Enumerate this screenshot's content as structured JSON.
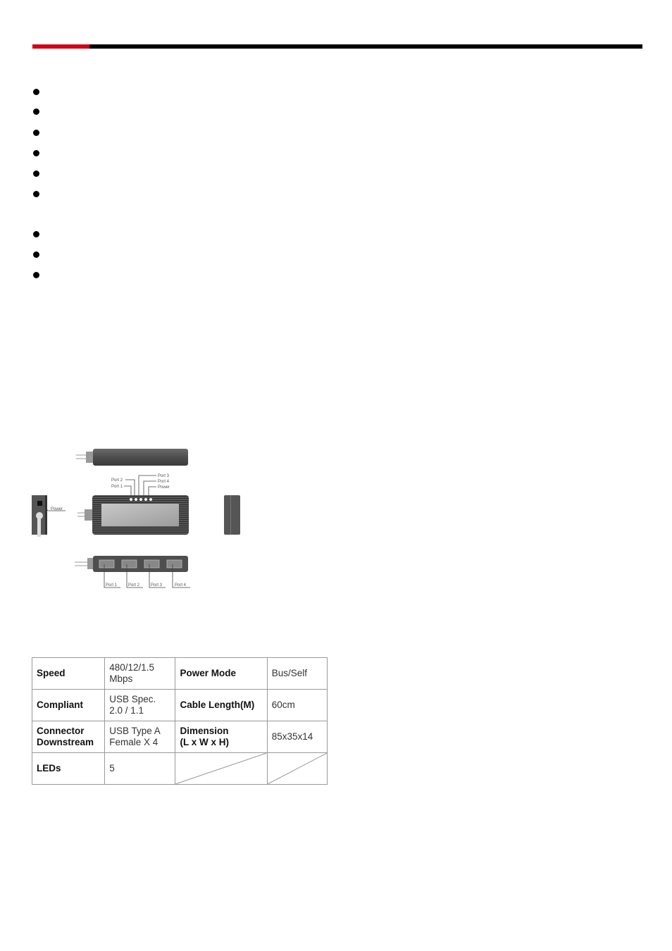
{
  "header": {
    "accent_color": "#d0021b",
    "rule_color": "#000000"
  },
  "bullets": {
    "group1": [
      "",
      "",
      "",
      "",
      "",
      ""
    ],
    "group2": [
      "",
      "",
      ""
    ]
  },
  "diagram": {
    "top_labels": [
      "Port 2",
      "Port 1",
      "Port 3",
      "Port 4",
      "Power"
    ],
    "side_label": "Power",
    "bottom_labels": [
      "Port 1",
      "Port 2",
      "Port 3",
      "Port 4"
    ]
  },
  "spec_table": {
    "rows": [
      [
        {
          "text": "Speed",
          "kind": "key"
        },
        {
          "text": "480/12/1.5\nMbps",
          "kind": "value"
        },
        {
          "text": "Power Mode",
          "kind": "key"
        },
        {
          "text": "Bus/Self",
          "kind": "value"
        }
      ],
      [
        {
          "text": "Compliant",
          "kind": "key"
        },
        {
          "text": "USB Spec.\n2.0 / 1.1",
          "kind": "value"
        },
        {
          "text": "Cable Length(M)",
          "kind": "key"
        },
        {
          "text": "60cm",
          "kind": "value"
        }
      ],
      [
        {
          "text": "Connector\nDownstream",
          "kind": "key"
        },
        {
          "text": "USB Type A\nFemale X 4",
          "kind": "value"
        },
        {
          "text": "Dimension\n(L x W x H)",
          "kind": "key"
        },
        {
          "text": "85x35x14",
          "kind": "value"
        }
      ],
      [
        {
          "text": "LEDs",
          "kind": "key"
        },
        {
          "text": "5",
          "kind": "value"
        },
        {
          "text": "",
          "kind": "empty"
        },
        {
          "text": "",
          "kind": "empty"
        }
      ]
    ]
  }
}
